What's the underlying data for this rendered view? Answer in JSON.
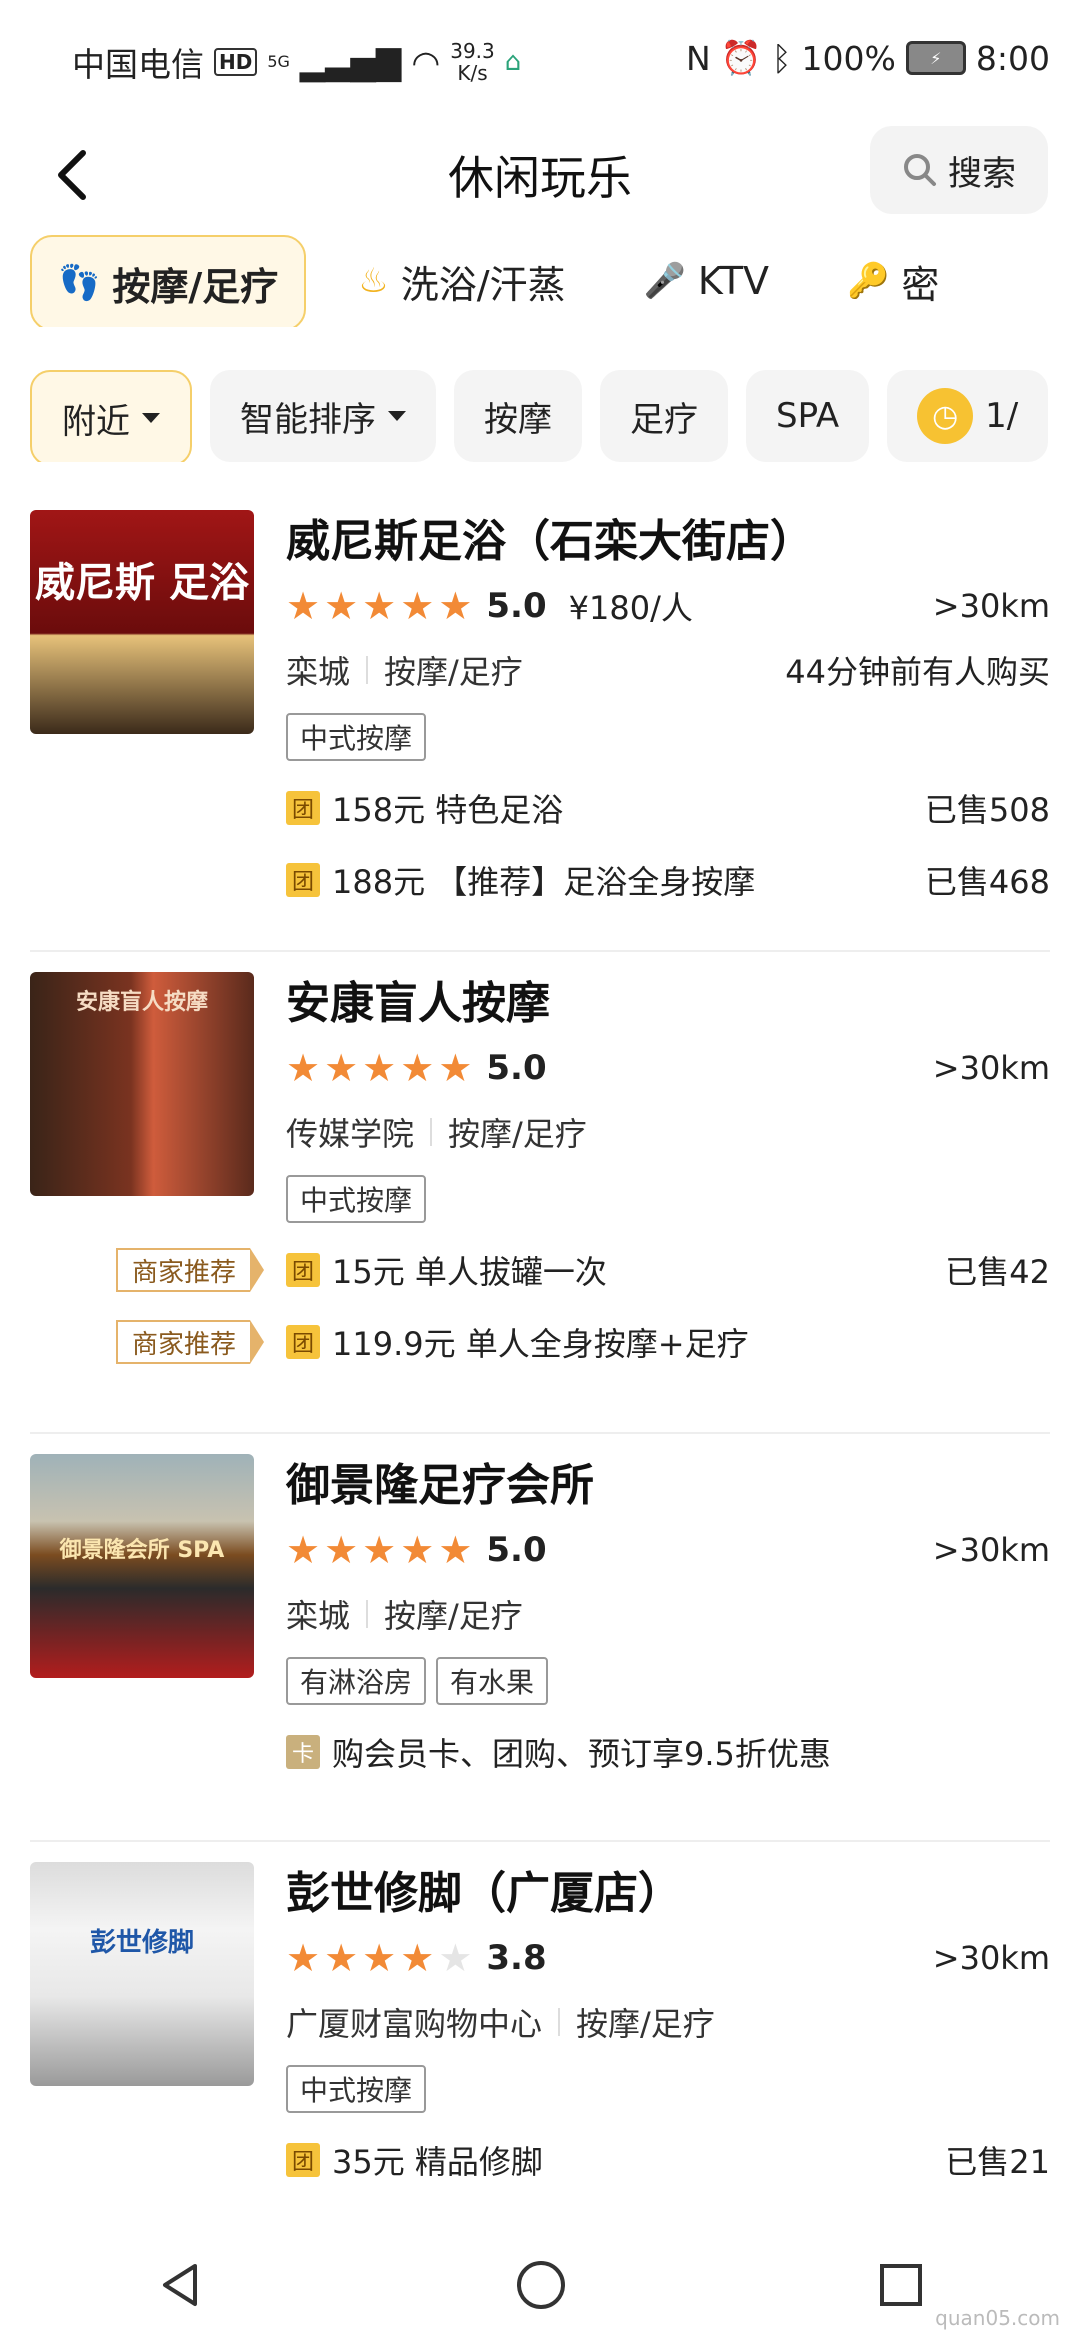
{
  "status": {
    "carrier": "中国电信",
    "hd": "HD",
    "net": "5G",
    "speed_value": "39.3",
    "speed_unit": "K/s",
    "battery": "100%",
    "time": "8:00"
  },
  "header": {
    "title": "休闲玩乐",
    "search_label": "搜索"
  },
  "categories": [
    {
      "label": "按摩/足疗",
      "icon": "foot-icon"
    },
    {
      "label": "洗浴/汗蒸",
      "icon": "bath-icon"
    },
    {
      "label": "KTV",
      "icon": "mic-icon"
    },
    {
      "label": "密",
      "icon": "key-icon"
    }
  ],
  "filters": [
    {
      "label": "附近"
    },
    {
      "label": "智能排序"
    },
    {
      "label": "按摩"
    },
    {
      "label": "足疗"
    },
    {
      "label": "SPA"
    },
    {
      "label": "1/"
    }
  ],
  "shops": [
    {
      "name": "威尼斯足浴（石栾大街店）",
      "thumb_text": "威尼斯 足浴",
      "rating": "5.0",
      "stars": 5,
      "price": "¥180/人",
      "distance": ">30km",
      "area": "栾城",
      "category": "按摩/足疗",
      "recent": "44分钟前有人购买",
      "tags": [
        "中式按摩"
      ],
      "deals": [
        {
          "icon": "团",
          "text": "158元 特色足浴",
          "sold": "已售508",
          "merchant": ""
        },
        {
          "icon": "团",
          "text": "188元 【推荐】足浴全身按摩",
          "sold": "已售468",
          "merchant": ""
        }
      ]
    },
    {
      "name": "安康盲人按摩",
      "thumb_text": "安康盲人按摩",
      "rating": "5.0",
      "stars": 5,
      "price": "",
      "distance": ">30km",
      "area": "传媒学院",
      "category": "按摩/足疗",
      "recent": "",
      "tags": [
        "中式按摩"
      ],
      "deals": [
        {
          "icon": "团",
          "text": "15元 单人拔罐一次",
          "sold": "已售42",
          "merchant": "商家推荐"
        },
        {
          "icon": "团",
          "text": "119.9元 单人全身按摩+足疗",
          "sold": "",
          "merchant": "商家推荐"
        }
      ]
    },
    {
      "name": "御景隆足疗会所",
      "thumb_text": "御景隆会所 SPA",
      "rating": "5.0",
      "stars": 5,
      "price": "",
      "distance": ">30km",
      "area": "栾城",
      "category": "按摩/足疗",
      "recent": "",
      "tags": [
        "有淋浴房",
        "有水果"
      ],
      "deals": [
        {
          "icon": "卡",
          "text": "购会员卡、团购、预订享9.5折优惠",
          "sold": "",
          "merchant": ""
        }
      ]
    },
    {
      "name": "彭世修脚（广厦店）",
      "thumb_text": "彭世修脚",
      "rating": "3.8",
      "stars": 4,
      "price": "",
      "distance": ">30km",
      "area": "广厦财富购物中心",
      "category": "按摩/足疗",
      "recent": "",
      "tags": [
        "中式按摩"
      ],
      "deals": [
        {
          "icon": "团",
          "text": "35元 精品修脚",
          "sold": "已售21",
          "merchant": ""
        }
      ]
    }
  ],
  "watermark": "quan05.com",
  "colors": {
    "accent": "#f28a36",
    "chip_active_bg": "#fff8e6",
    "deal_badge": "#f6c33b"
  }
}
